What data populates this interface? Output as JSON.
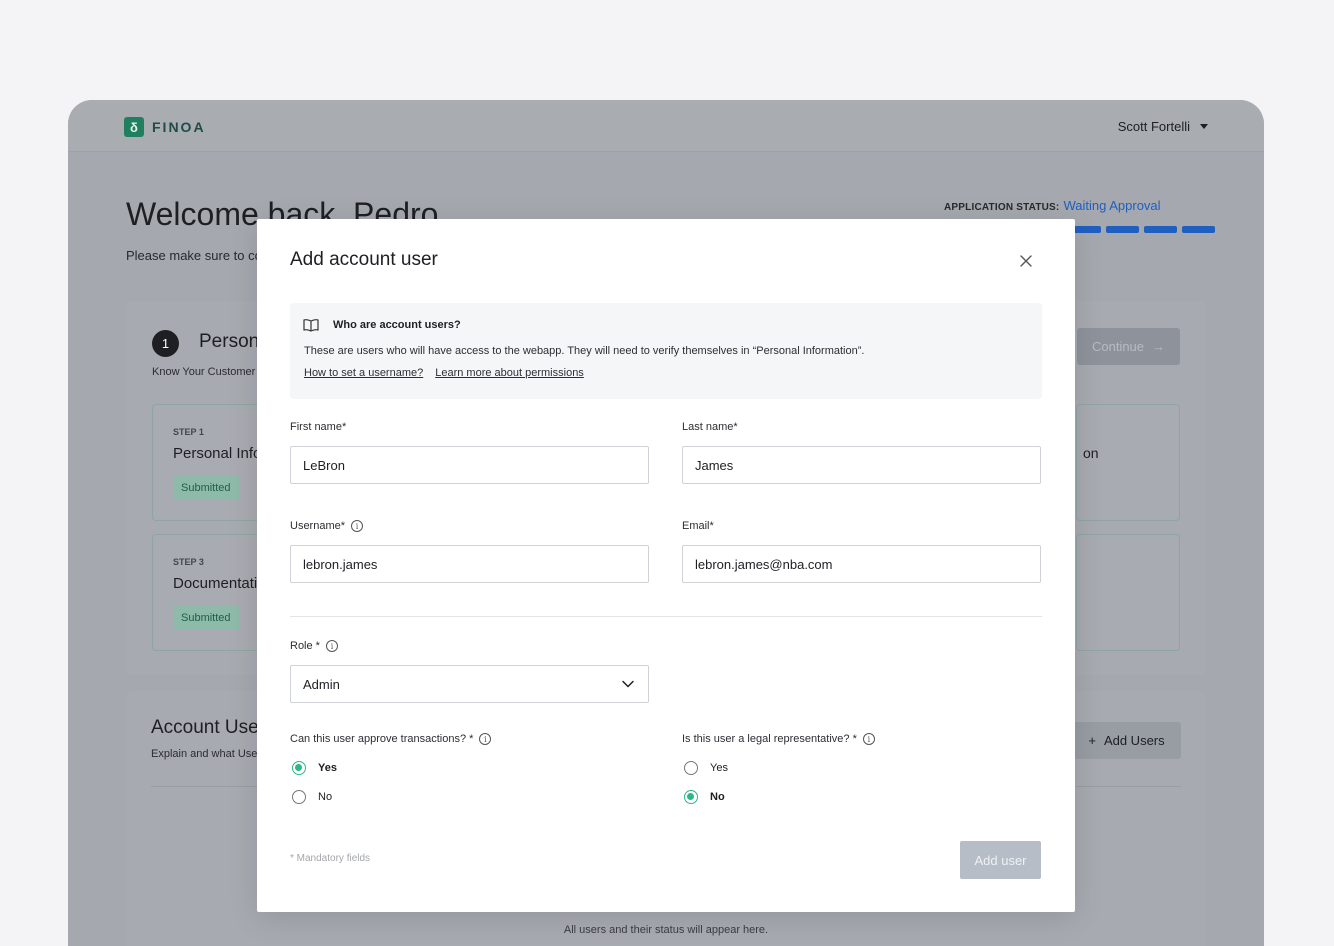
{
  "header": {
    "brand": "FINOA",
    "brand_mark": "δ",
    "user_name": "Scott Fortelli"
  },
  "dashboard": {
    "welcome": "Welcome back, Pedro",
    "welcome_sub": "Please make sure to co",
    "status_label": "APPLICATION STATUS:",
    "status_value": "Waiting Approval",
    "progress_segments": 4,
    "section_number": "1",
    "section_title": "Person",
    "section_sub": "Know Your Customer",
    "continue_label": "Continue",
    "steps": [
      {
        "label": "STEP 1",
        "title": "Personal Info",
        "status": "Submitted"
      },
      {
        "label": "STEP 3",
        "title": "Documentati",
        "status": "Submitted"
      }
    ],
    "right_fragment": "on",
    "account_title": "Account Use",
    "account_sub": "Explain and what Use",
    "add_users_label": "Add Users",
    "empty_note": "All users and their status will appear here."
  },
  "modal": {
    "title": "Add account user",
    "info": {
      "heading": "Who are account users?",
      "text": "These are users who will have access to the webapp. They will need to verify themselves in “Personal Information”.",
      "link_username": "How to set a username?",
      "link_permissions": "Learn more about permissions"
    },
    "first_name": {
      "label": "First name*",
      "value": "LeBron"
    },
    "last_name": {
      "label": "Last name*",
      "value": "James"
    },
    "username": {
      "label": "Username*",
      "value": "lebron.james"
    },
    "email": {
      "label": "Email*",
      "value": "lebron.james@nba.com"
    },
    "role": {
      "label": "Role *",
      "value": "Admin"
    },
    "approve": {
      "label": "Can this user approve transactions? *",
      "options": [
        "Yes",
        "No"
      ],
      "selected": "Yes"
    },
    "legal": {
      "label": "Is this user a legal representative? *",
      "options": [
        "Yes",
        "No"
      ],
      "selected": "No"
    },
    "mandatory_note": "* Mandatory fields",
    "submit_label": "Add user"
  },
  "colors": {
    "accent_green": "#2fb588",
    "status_blue": "#1f5fbf",
    "brand_green": "#1f7f5f"
  }
}
